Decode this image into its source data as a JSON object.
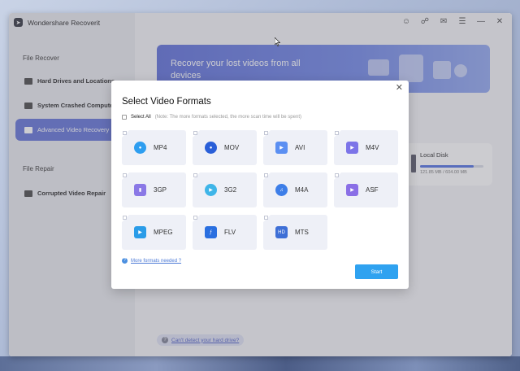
{
  "app": {
    "title": "Wondershare Recoverit"
  },
  "sidebar": {
    "section_recover": "File Recover",
    "items": [
      {
        "label": "Hard Drives and Locations"
      },
      {
        "label": "System Crashed Computer"
      },
      {
        "label": "Advanced Video Recovery"
      }
    ],
    "section_repair": "File Repair",
    "repair_items": [
      {
        "label": "Corrupted Video Repair"
      }
    ]
  },
  "header": {
    "icons": [
      "user-icon",
      "headset-icon",
      "mail-icon",
      "menu-icon",
      "minimize-icon",
      "close-icon"
    ],
    "glyphs": [
      "&#9786;",
      "&#9741;",
      "&#9993;",
      "&#9776;",
      "&#8212;",
      "&#10005;"
    ]
  },
  "banner": {
    "text": "Recover your lost videos from all devices"
  },
  "disk": {
    "name": "Local Disk",
    "size": "121.85 MB / 604.00 MB",
    "used_fraction": 0.85
  },
  "bottom_link": {
    "text": "Can't detect your hard drive?"
  },
  "dialog": {
    "title": "Select Video Formats",
    "select_all": "Select All",
    "note": "(Note: The more formats selected, the more scan time will be spent)",
    "formats": [
      {
        "label": "MP4",
        "color": "#2e9ef0"
      },
      {
        "label": "MOV",
        "color": "#2a5fd8"
      },
      {
        "label": "AVI",
        "color": "#5b8ff2"
      },
      {
        "label": "M4V",
        "color": "#7c74e8"
      },
      {
        "label": "3GP",
        "color": "#8a78e6"
      },
      {
        "label": "3G2",
        "color": "#3fb5e8"
      },
      {
        "label": "M4A",
        "color": "#3d7ee8"
      },
      {
        "label": "ASF",
        "color": "#8a6fe6"
      },
      {
        "label": "MPEG",
        "color": "#2a9ce8"
      },
      {
        "label": "FLV",
        "color": "#2a6fe0"
      },
      {
        "label": "MTS",
        "color": "#3e6fd6"
      }
    ],
    "more_formats": "More formats needed ?",
    "start": "Start"
  }
}
